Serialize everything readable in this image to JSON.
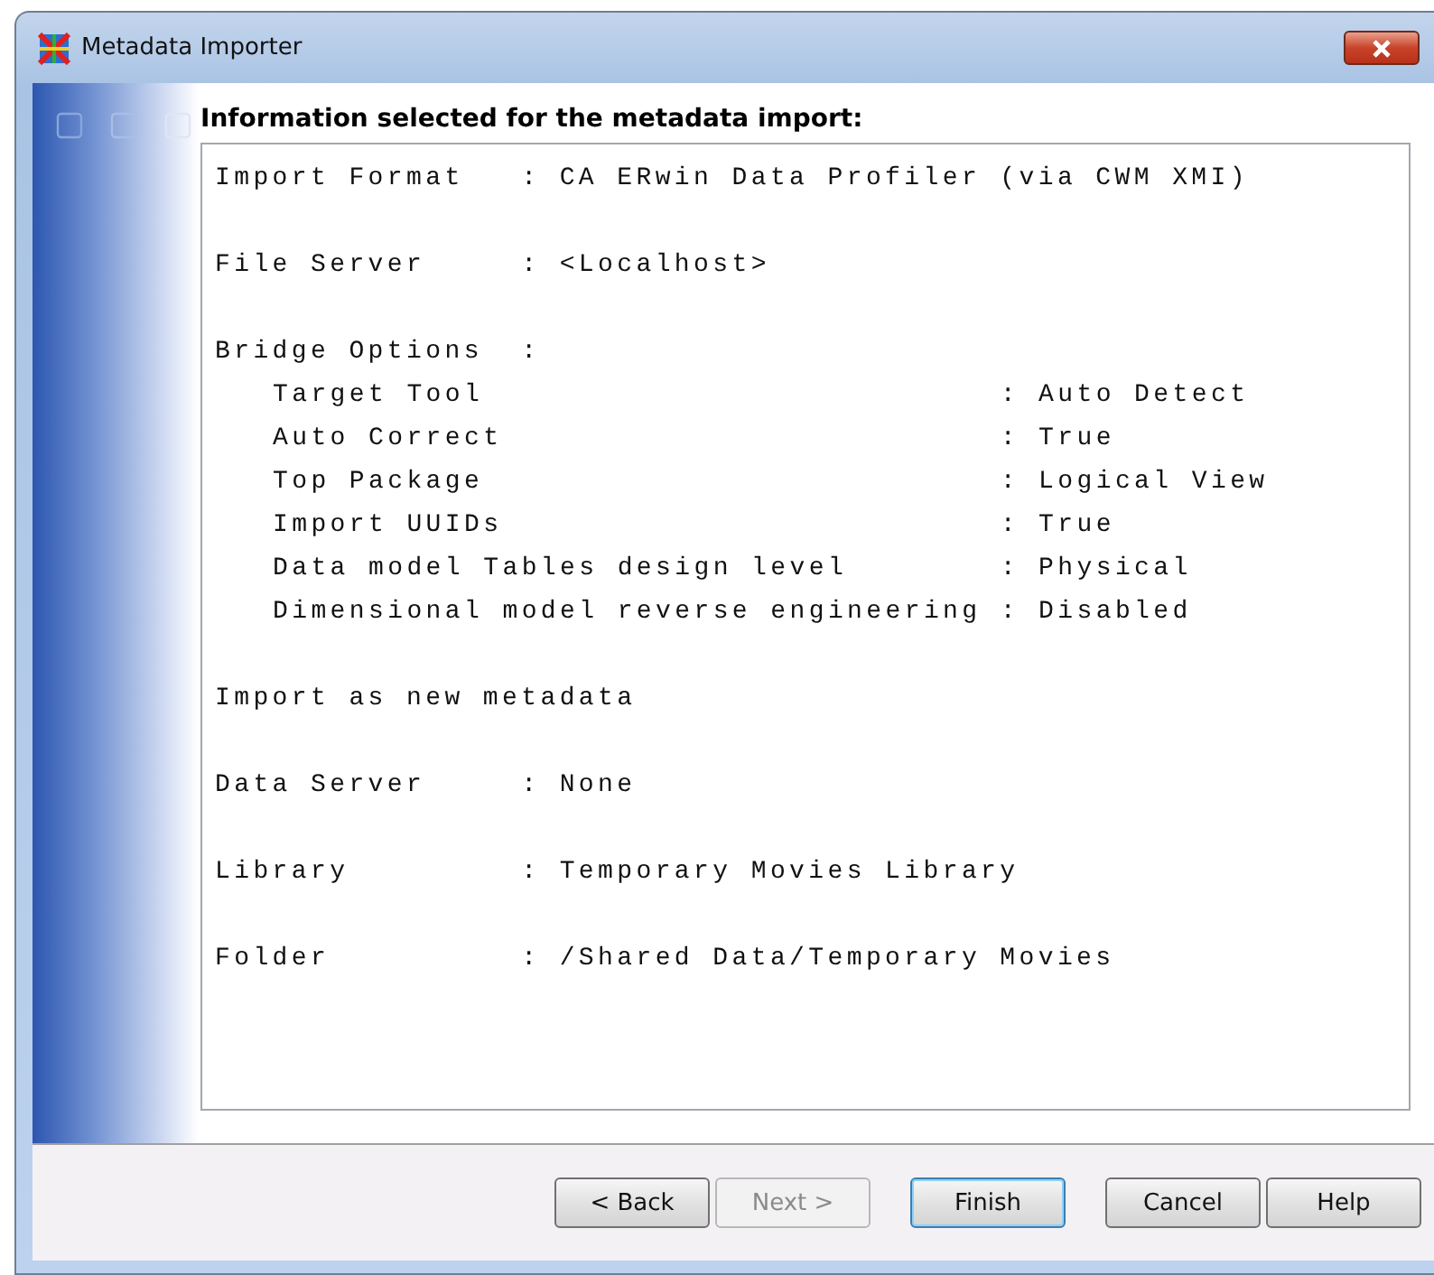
{
  "window": {
    "title": "Metadata Importer"
  },
  "heading": "Information selected for the metadata import:",
  "summary": [
    {
      "lines": [
        {
          "kind": "field",
          "text": "Import Format   : CA ERwin Data Profiler (via CWM XMI)"
        }
      ]
    },
    {
      "lines": [
        {
          "kind": "field",
          "text": "File Server     : <Localhost>"
        }
      ]
    },
    {
      "lines": [
        {
          "kind": "field",
          "text": "Bridge Options  :"
        },
        {
          "kind": "option",
          "text": "Target Tool                           : Auto Detect"
        },
        {
          "kind": "option",
          "text": "Auto Correct                          : True"
        },
        {
          "kind": "option",
          "text": "Top Package                           : Logical View"
        },
        {
          "kind": "option",
          "text": "Import UUIDs                          : True"
        },
        {
          "kind": "option",
          "text": "Data model Tables design level        : Physical"
        },
        {
          "kind": "option",
          "text": "Dimensional model reverse engineering : Disabled"
        }
      ]
    },
    {
      "lines": [
        {
          "kind": "field",
          "text": "Import as new metadata"
        }
      ]
    },
    {
      "lines": [
        {
          "kind": "field",
          "text": "Data Server     : None"
        }
      ]
    },
    {
      "lines": [
        {
          "kind": "field",
          "text": "Library         : Temporary Movies Library"
        }
      ]
    },
    {
      "lines": [
        {
          "kind": "field",
          "text": "Folder          : /Shared Data/Temporary Movies"
        }
      ]
    }
  ],
  "buttons": [
    {
      "label": "< Back",
      "disabled": false,
      "default": false
    },
    {
      "label": "Next >",
      "disabled": true,
      "default": false
    },
    {
      "label": "Finish",
      "disabled": false,
      "default": true
    },
    {
      "label": "Cancel",
      "disabled": false,
      "default": false
    },
    {
      "label": "Help",
      "disabled": false,
      "default": false
    }
  ]
}
